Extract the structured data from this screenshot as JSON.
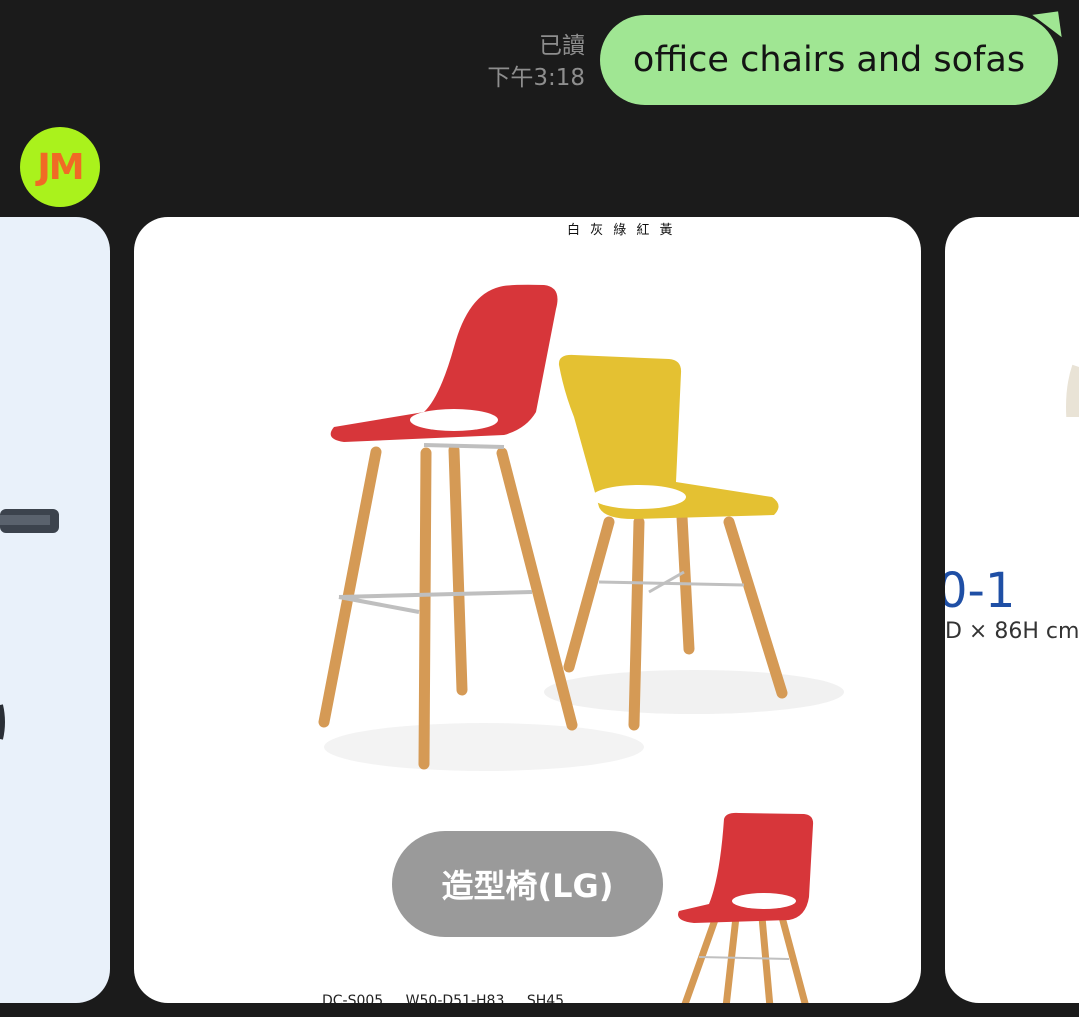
{
  "message": {
    "read_status": "已讀",
    "time": "下午3:18",
    "text": "office chairs and sofas"
  },
  "sender": {
    "avatar_initials": "JM",
    "avatar_bg": "#aaf21c",
    "avatar_text_color": "#f06a25"
  },
  "carousel": {
    "main_card": {
      "colors_text": "白 灰 綠 紅 黃",
      "spec": [
        "DC-S005",
        "W50-D51-H83",
        "SH45"
      ],
      "label": "造型椅(LG)"
    },
    "right_card": {
      "model_fragment": "0-1",
      "dims_fragment": "D × 86H cm"
    }
  }
}
